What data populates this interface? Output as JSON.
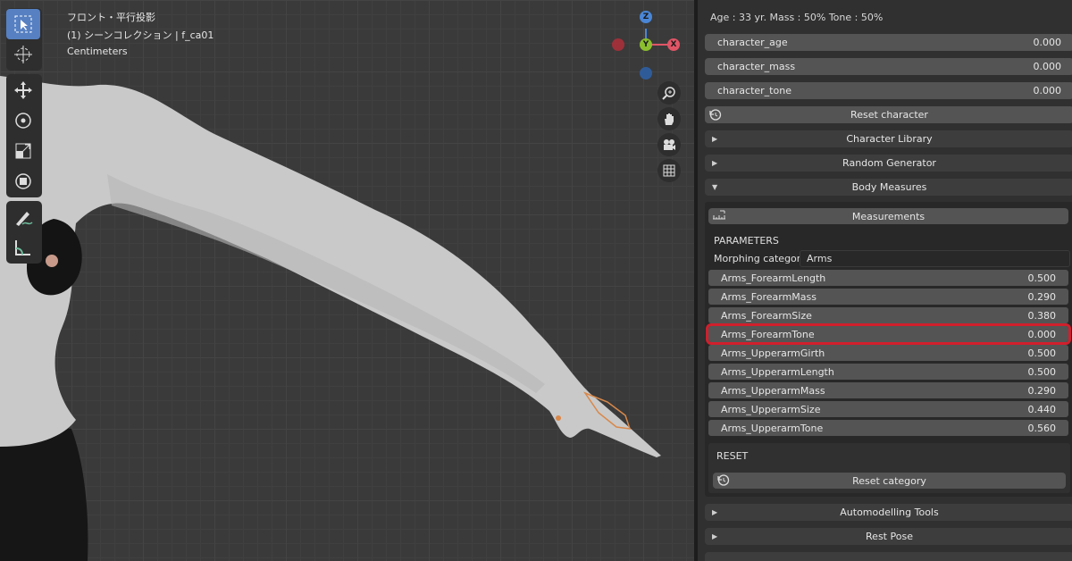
{
  "viewport": {
    "view_name": "フロント・平行投影",
    "collection": "(1) シーンコレクション | f_ca01",
    "units": "Centimeters",
    "gizmo": {
      "z": "Z",
      "y": "Y",
      "x": "X"
    }
  },
  "toolbar": {
    "tools": [
      "select-box-icon",
      "cursor-icon",
      "move-icon",
      "rotate-icon",
      "scale-icon",
      "transform-icon",
      "annotate-icon",
      "measure-icon"
    ]
  },
  "nav": [
    "zoom-icon",
    "hand-icon",
    "camera-icon",
    "grid-icon"
  ],
  "panel": {
    "header": "Age : 33 yr.  Mass : 50%  Tone : 50%",
    "props": [
      {
        "label": "character_age",
        "value": "0.000"
      },
      {
        "label": "character_mass",
        "value": "0.000"
      },
      {
        "label": "character_tone",
        "value": "0.000"
      }
    ],
    "reset_character": "Reset character",
    "character_library": "Character Library",
    "random_generator": "Random Generator",
    "body_measures": "Body Measures",
    "measurements": "Measurements",
    "parameters_label": "PARAMETERS",
    "morph_label": "Morphing categor..",
    "morph_value": "Arms",
    "params": [
      {
        "label": "Arms_ForearmLength",
        "value": "0.500"
      },
      {
        "label": "Arms_ForearmMass",
        "value": "0.290"
      },
      {
        "label": "Arms_ForearmSize",
        "value": "0.380"
      },
      {
        "label": "Arms_ForearmTone",
        "value": "0.000"
      },
      {
        "label": "Arms_UpperarmGirth",
        "value": "0.500"
      },
      {
        "label": "Arms_UpperarmLength",
        "value": "0.500"
      },
      {
        "label": "Arms_UpperarmMass",
        "value": "0.290"
      },
      {
        "label": "Arms_UpperarmSize",
        "value": "0.440"
      },
      {
        "label": "Arms_UpperarmTone",
        "value": "0.560"
      }
    ],
    "reset_label": "RESET",
    "reset_category": "Reset category",
    "automodelling": "Automodelling Tools",
    "rest_pose": "Rest Pose"
  },
  "colors": {
    "accent": "#5680c2",
    "highlight": "#d11f2c",
    "x_axis": "#e05566",
    "y_axis": "#8bbf2e",
    "z_axis": "#4a86d6"
  }
}
